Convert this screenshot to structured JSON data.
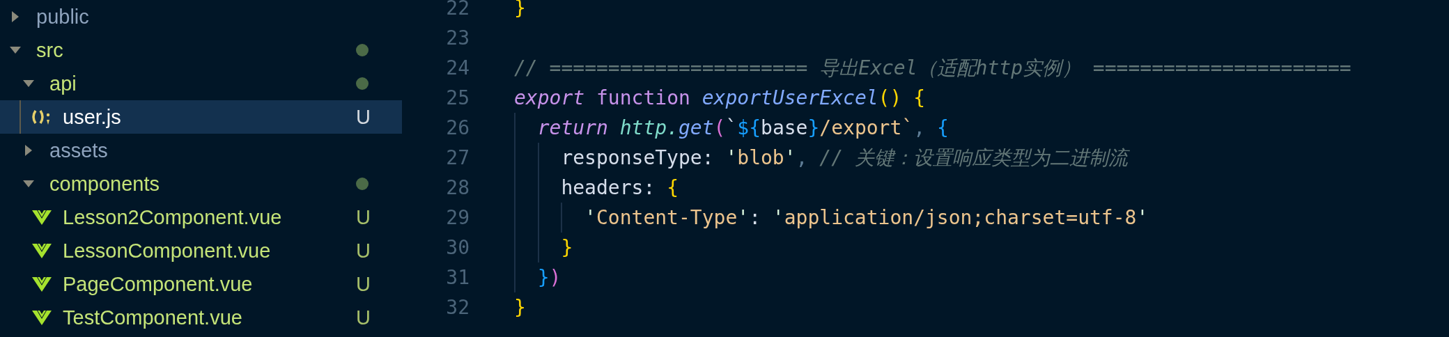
{
  "sidebar": {
    "items": [
      {
        "label": "public",
        "kind": "folder",
        "expanded": false,
        "selected": false,
        "changed": false
      },
      {
        "label": "src",
        "kind": "folder",
        "expanded": true,
        "selected": false,
        "changed": true,
        "children": [
          {
            "label": "api",
            "kind": "folder",
            "expanded": true,
            "selected": false,
            "changed": true,
            "children": [
              {
                "label": "user.js",
                "kind": "js",
                "selected": true,
                "changed": true,
                "badge": "U"
              }
            ]
          },
          {
            "label": "assets",
            "kind": "folder",
            "expanded": false,
            "selected": false,
            "changed": false
          },
          {
            "label": "components",
            "kind": "folder",
            "expanded": true,
            "selected": false,
            "changed": true,
            "children": [
              {
                "label": "Lesson2Component.vue",
                "kind": "vue",
                "selected": false,
                "changed": true,
                "badge": "U"
              },
              {
                "label": "LessonComponent.vue",
                "kind": "vue",
                "selected": false,
                "changed": true,
                "badge": "U"
              },
              {
                "label": "PageComponent.vue",
                "kind": "vue",
                "selected": false,
                "changed": true,
                "badge": "U"
              },
              {
                "label": "TestComponent.vue",
                "kind": "vue",
                "selected": false,
                "changed": true,
                "badge": "U"
              }
            ]
          }
        ]
      }
    ]
  },
  "editor": {
    "lines": [
      {
        "number": "22",
        "tokens": [
          {
            "text": "}",
            "kind": "yellow"
          }
        ]
      },
      {
        "number": "23"
      },
      {
        "number": "24",
        "tokens": [
          {
            "text": "// ====================== 导出Excel（适配http实例） ======================",
            "kind": "comment"
          }
        ]
      },
      {
        "number": "25",
        "tokens": [
          {
            "text": "export",
            "kind": "keyword"
          },
          {
            "text": " function",
            "kind": "storage"
          },
          {
            "text": " exportUserExcel",
            "kind": "func"
          },
          {
            "text": "()",
            "kind": "yellow"
          },
          {
            "text": " {",
            "kind": "yellow"
          }
        ]
      },
      {
        "number": "26",
        "tokens": [
          {
            "text": "  return",
            "kind": "keyword"
          },
          {
            "text": " http.",
            "kind": "prop"
          },
          {
            "text": "get",
            "kind": "func"
          },
          {
            "text": "(",
            "kind": "pink"
          },
          {
            "text": "`",
            "kind": "plain"
          },
          {
            "text": "${",
            "kind": "blue"
          },
          {
            "text": "base",
            "kind": "plain"
          },
          {
            "text": "}",
            "kind": "blue"
          },
          {
            "text": "/export`",
            "kind": "string"
          },
          {
            "text": ", ",
            "kind": "punct"
          },
          {
            "text": "{",
            "kind": "blue"
          }
        ]
      },
      {
        "number": "27",
        "tokens": [
          {
            "text": "    responseType: ",
            "kind": "plain"
          },
          {
            "text": "'",
            "kind": "quote"
          },
          {
            "text": "blob",
            "kind": "string"
          },
          {
            "text": "'",
            "kind": "quote"
          },
          {
            "text": ",",
            "kind": "punct"
          },
          {
            "text": " // 关键：设置响应类型为二进制流",
            "kind": "comment"
          }
        ]
      },
      {
        "number": "28",
        "tokens": [
          {
            "text": "    headers: ",
            "kind": "plain"
          },
          {
            "text": "{",
            "kind": "yellow"
          }
        ]
      },
      {
        "number": "29",
        "tokens": [
          {
            "text": "      '",
            "kind": "quote"
          },
          {
            "text": "Content-Type",
            "kind": "string"
          },
          {
            "text": "'",
            "kind": "quote"
          },
          {
            "text": ": ",
            "kind": "plain"
          },
          {
            "text": "'",
            "kind": "quote"
          },
          {
            "text": "application/json;charset=utf-8",
            "kind": "string"
          },
          {
            "text": "'",
            "kind": "quote"
          }
        ]
      },
      {
        "number": "30",
        "tokens": [
          {
            "text": "    }",
            "kind": "yellow"
          }
        ]
      },
      {
        "number": "31",
        "tokens": [
          {
            "text": "  }",
            "kind": "blue"
          },
          {
            "text": ")",
            "kind": "pink"
          }
        ]
      },
      {
        "number": "32",
        "tokens": [
          {
            "text": "}",
            "kind": "yellow"
          }
        ]
      }
    ]
  }
}
